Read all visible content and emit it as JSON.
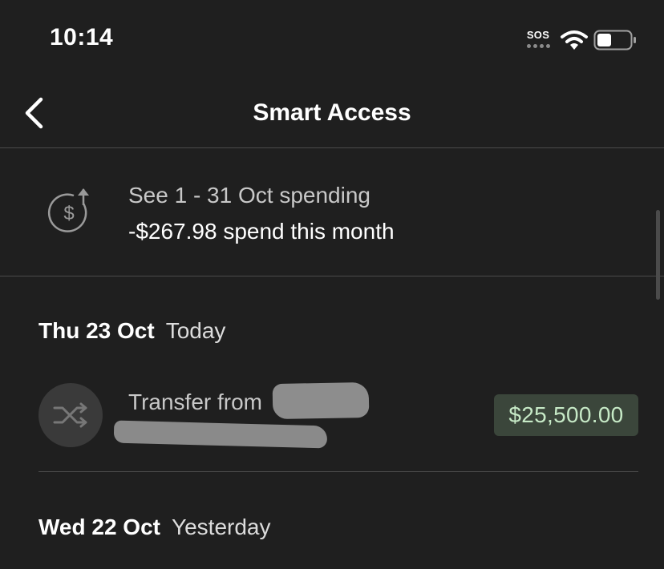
{
  "status_bar": {
    "time": "10:14",
    "sos": "SOS",
    "icons": [
      "wifi-icon",
      "battery-icon"
    ]
  },
  "nav": {
    "title": "Smart Access",
    "back_icon": "chevron-left-icon"
  },
  "spending": {
    "line1": "See 1 - 31 Oct spending",
    "line2": "-$267.98 spend this month",
    "icon": "dollar-cycle-icon"
  },
  "sections": [
    {
      "date": "Thu 23 Oct",
      "relative": "Today",
      "transactions": [
        {
          "label": "Transfer from",
          "amount": "$25,500.00",
          "icon": "shuffle-icon"
        }
      ]
    },
    {
      "date": "Wed 22 Oct",
      "relative": "Yesterday"
    }
  ],
  "colors": {
    "background": "#1f1f1f",
    "amount_bg": "#3b463b",
    "amount_text": "#c6e9c6",
    "icon_circle": "#3a3a3a"
  }
}
